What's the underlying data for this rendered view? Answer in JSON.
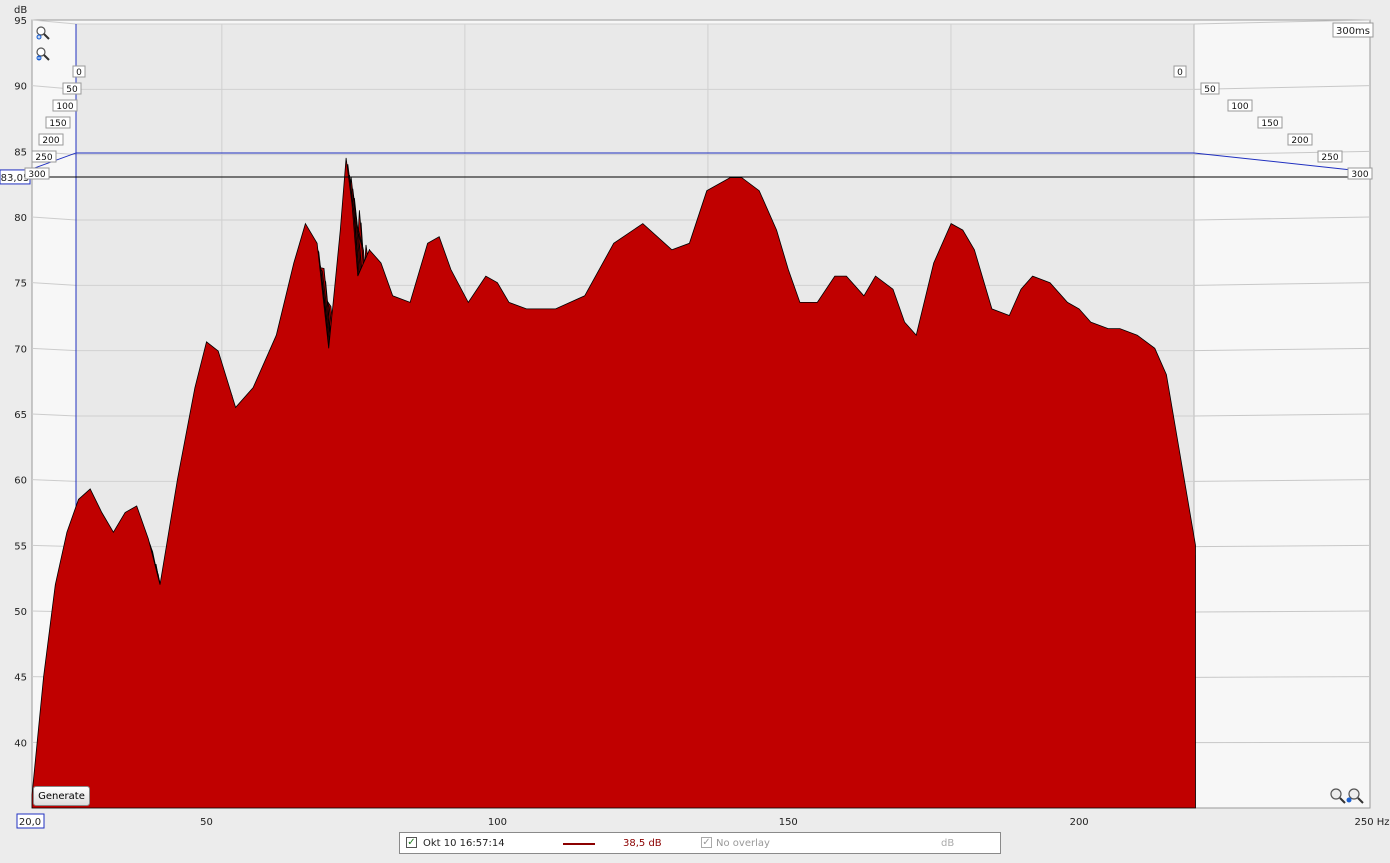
{
  "chart_data": {
    "type": "area",
    "style": "waterfall",
    "xlabel_unit": "Hz",
    "ylabel_unit": "dB",
    "x_axis": {
      "min": 20,
      "max": 250,
      "ticks": [
        50,
        100,
        150,
        200
      ],
      "min_label": "20,0",
      "max_label": "250 Hz"
    },
    "y_axis": {
      "min": 35,
      "max": 95,
      "ticks": [
        40,
        45,
        50,
        55,
        60,
        65,
        70,
        75,
        80,
        85,
        90,
        95
      ]
    },
    "time_axis": {
      "unit": "ms",
      "max_label": "300ms",
      "ticks": [
        "0",
        "50",
        "100",
        "150",
        "200",
        "250",
        "300"
      ]
    },
    "cursor_level": "83,05",
    "fill_color": "#b00000",
    "outline_color": "#000000",
    "slices": 30,
    "front_curve": {
      "x": [
        20,
        22,
        24,
        26,
        28,
        30,
        32,
        34,
        36,
        38,
        40,
        42,
        45,
        48,
        50,
        52,
        55,
        58,
        62,
        65,
        67,
        69,
        71,
        73,
        74,
        75,
        76,
        78,
        80,
        82,
        85,
        88,
        90,
        92,
        95,
        98,
        100,
        102,
        105,
        108,
        110,
        115,
        120,
        125,
        130,
        133,
        136,
        140,
        142,
        145,
        148,
        150,
        152,
        155,
        158,
        160,
        163,
        165,
        168,
        170,
        172,
        175,
        178,
        180,
        182,
        185,
        188,
        190,
        192,
        195,
        198,
        200,
        202,
        205,
        207,
        210,
        213,
        215,
        220
      ],
      "y": [
        36,
        45,
        52,
        56,
        58.5,
        59.3,
        57.5,
        56,
        57.5,
        58,
        55.5,
        52,
        60,
        67,
        70.5,
        69.8,
        65.5,
        67,
        71,
        76.5,
        79.5,
        78,
        70,
        79,
        84.5,
        81,
        75.5,
        77.5,
        76.5,
        74,
        73.5,
        78,
        78.5,
        76,
        73.5,
        75.5,
        75,
        73.5,
        73,
        73,
        73,
        74,
        78,
        79.5,
        77.5,
        78,
        82,
        83,
        83,
        82,
        79,
        76,
        73.5,
        73.5,
        75.5,
        75.5,
        74,
        75.5,
        74.5,
        72,
        71,
        76.5,
        79.5,
        79,
        77.5,
        73,
        72.5,
        74.5,
        75.5,
        75,
        73.5,
        73,
        72,
        71.5,
        71.5,
        71,
        70,
        68,
        55
      ]
    }
  },
  "legend": {
    "measurement_label": "Okt 10 16:57:14",
    "level_value": "38,5 dB",
    "overlay_label": "No overlay",
    "unit_label": "dB"
  },
  "controls": {
    "generate_label": "Generate"
  }
}
